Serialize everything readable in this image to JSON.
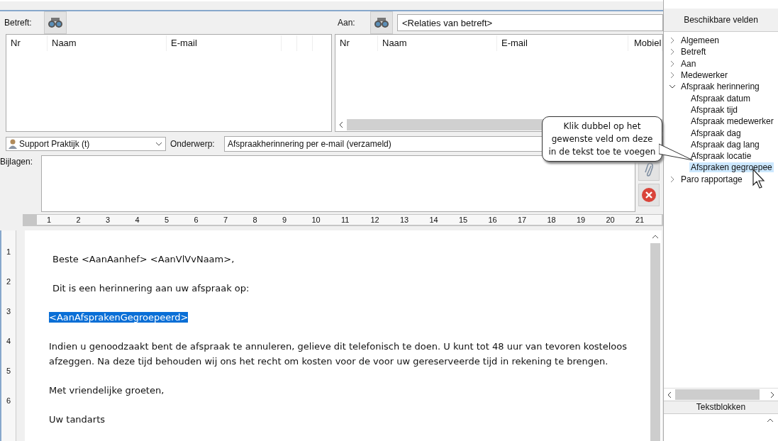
{
  "betreft": {
    "label": "Betreft:",
    "columns": [
      "Nr",
      "Naam",
      "E-mail"
    ]
  },
  "aan": {
    "label": "Aan:",
    "value": "<Relaties van betreft>",
    "columns": [
      "Nr",
      "Naam",
      "E-mail",
      "Mobiel"
    ]
  },
  "sender": {
    "value": "Support Praktijk (t)"
  },
  "subject": {
    "label": "Onderwerp:",
    "value": "Afspraakherinnering per e-mail (verzameld)"
  },
  "attachments": {
    "label": "Bijlagen:"
  },
  "ruler": [
    "1",
    "2",
    "3",
    "4",
    "5",
    "6",
    "7",
    "8",
    "9",
    "10",
    "11",
    "12",
    "13",
    "14",
    "15",
    "16",
    "17",
    "18",
    "19",
    "20",
    "21"
  ],
  "vertical_ruler": [
    "1",
    "2",
    "3",
    "4",
    "5",
    "6"
  ],
  "document": [
    {
      "text": "Beste <AanAanhef> <AanVlVvNaam>,",
      "selected": false
    },
    {
      "text": "Dit is een herinnering aan uw afspraak op:",
      "selected": false
    },
    {
      "text": "<AanAfsprakenGegroepeerd>",
      "selected": true
    },
    {
      "text": "Indien u genoodzaakt bent de afspraak te annuleren, gelieve dit telefonisch te doen. U kunt tot 48 uur van tevoren kosteloos afzeggen. Na deze tijd behouden wij ons het recht om kosten voor de voor uw gereserveerde tijd in rekening te brengen.",
      "selected": false
    },
    {
      "text": "Met vriendelijke groeten,",
      "selected": false
    },
    {
      "text": "Uw tandarts",
      "selected": false
    }
  ],
  "fields_panel": {
    "title": "Beschikbare velden",
    "tree": [
      {
        "label": "Algemeen",
        "expanded": false,
        "selected": false
      },
      {
        "label": "Betreft",
        "expanded": false,
        "selected": false
      },
      {
        "label": "Aan",
        "expanded": false,
        "selected": false
      },
      {
        "label": "Medewerker",
        "expanded": false,
        "selected": false
      },
      {
        "label": "Afspraak herinnering",
        "expanded": true,
        "selected": false,
        "children": [
          {
            "label": "Afspraak datum",
            "selected": false
          },
          {
            "label": "Afspraak tijd",
            "selected": false
          },
          {
            "label": "Afspraak medewerker",
            "selected": false
          },
          {
            "label": "Afspraak dag",
            "selected": false
          },
          {
            "label": "Afspraak dag lang",
            "selected": false
          },
          {
            "label": "Afspraak locatie",
            "selected": false
          },
          {
            "label": "Afspraken gegroepee",
            "selected": true
          }
        ]
      },
      {
        "label": "Paro rapportage",
        "expanded": false,
        "selected": false
      }
    ]
  },
  "tooltip": "Klik dubbel op het gewenste veld om deze in de tekst toe te voegen",
  "textblocks": {
    "title": "Tekstblokken"
  }
}
